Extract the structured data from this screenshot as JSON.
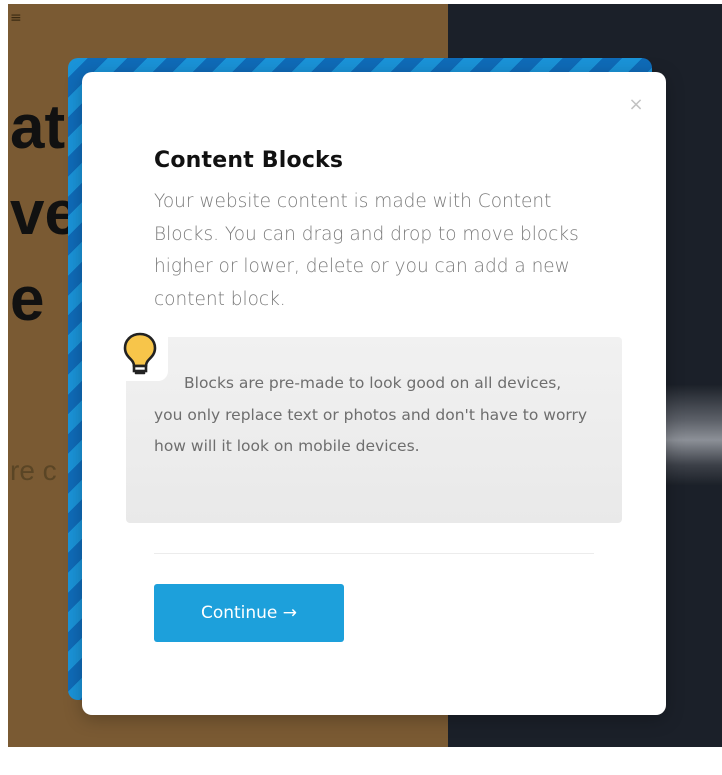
{
  "background": {
    "menu_glyph": "≡",
    "heading_lines": "at\nve\ne",
    "sub_fragment": "re c"
  },
  "modal": {
    "close_label": "×",
    "title": "Content Blocks",
    "description": "Your website content is made with Content Blocks. You can drag and drop to move blocks higher or lower, delete or you can add a new content block.",
    "tip_icon": "lightbulb-icon",
    "tip_text": "Blocks are pre-made to look good on all devices, you only replace text or photos and don't have to worry how will it look on mobile devices.",
    "continue_label": "Continue →"
  },
  "colors": {
    "accent": "#1da0db",
    "stripe_light": "#1a93d8",
    "stripe_dark": "#0f6bb8",
    "bulb": "#f7c54a"
  }
}
